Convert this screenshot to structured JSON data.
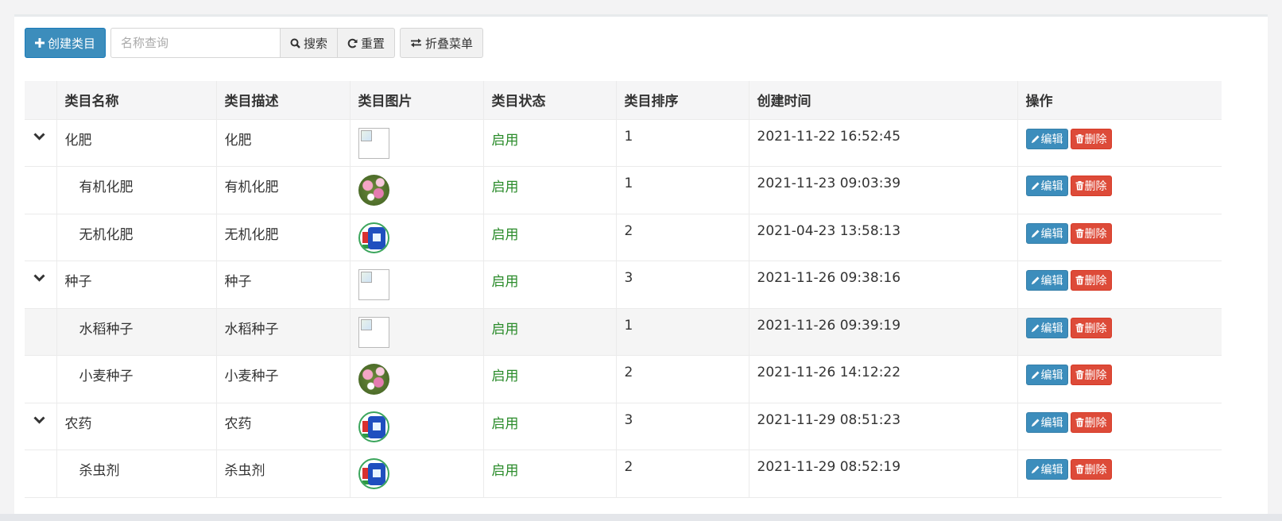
{
  "toolbar": {
    "create_label": "创建类目",
    "search_placeholder": "名称查询",
    "search_label": "搜索",
    "reset_label": "重置",
    "fold_label": "折叠菜单"
  },
  "table": {
    "headers": [
      "类目名称",
      "类目描述",
      "类目图片",
      "类目状态",
      "类目排序",
      "创建时间",
      "操作"
    ],
    "edit_label": "编辑",
    "delete_label": "删除",
    "rows": [
      {
        "name": "化肥",
        "desc": "化肥",
        "image": "broken",
        "status": "启用",
        "sort": "1",
        "created": "2021-11-22 16:52:45",
        "parent": true
      },
      {
        "name": "有机化肥",
        "desc": "有机化肥",
        "image": "flower",
        "status": "启用",
        "sort": "1",
        "created": "2021-11-23 09:03:39",
        "parent": false
      },
      {
        "name": "无机化肥",
        "desc": "无机化肥",
        "image": "bag",
        "status": "启用",
        "sort": "2",
        "created": "2021-04-23 13:58:13",
        "parent": false
      },
      {
        "name": "种子",
        "desc": "种子",
        "image": "broken",
        "status": "启用",
        "sort": "3",
        "created": "2021-11-26 09:38:16",
        "parent": true
      },
      {
        "name": "水稻种子",
        "desc": "水稻种子",
        "image": "broken",
        "status": "启用",
        "sort": "1",
        "created": "2021-11-26 09:39:19",
        "parent": false
      },
      {
        "name": "小麦种子",
        "desc": "小麦种子",
        "image": "flower",
        "status": "启用",
        "sort": "2",
        "created": "2021-11-26 14:12:22",
        "parent": false
      },
      {
        "name": "农药",
        "desc": "农药",
        "image": "bag",
        "status": "启用",
        "sort": "3",
        "created": "2021-11-29 08:51:23",
        "parent": true
      },
      {
        "name": "杀虫剂",
        "desc": "杀虫剂",
        "image": "bag",
        "status": "启用",
        "sort": "2",
        "created": "2021-11-29 08:52:19",
        "parent": false
      }
    ]
  },
  "colors": {
    "primary": "#3c8dbc",
    "danger": "#dd4b39",
    "status_on": "#2a8b2a"
  },
  "icons": {
    "create": "plus-icon",
    "search": "search-icon",
    "reset": "refresh-icon",
    "fold": "exchange-icon",
    "expand": "chevron-down-icon",
    "edit": "pencil-icon",
    "delete": "trash-icon"
  }
}
